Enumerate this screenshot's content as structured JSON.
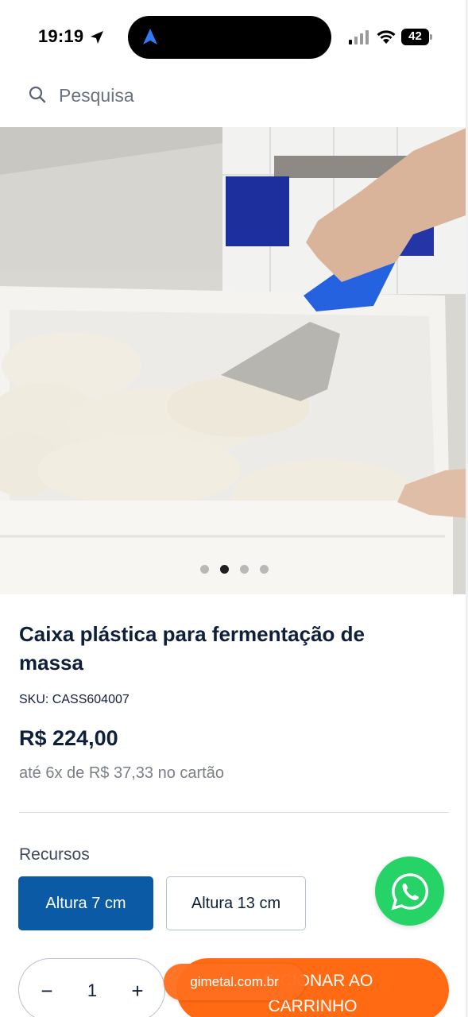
{
  "status_bar": {
    "time": "19:19",
    "battery": "42",
    "icons": [
      "location-arrow-icon",
      "navigation-arrow-icon",
      "cellular-signal-icon",
      "wifi-icon",
      "battery-icon"
    ]
  },
  "search": {
    "placeholder": "Pesquisa",
    "icon": "search-icon"
  },
  "gallery": {
    "image_count": 4,
    "active_index": 1
  },
  "product": {
    "title": "Caixa plástica para fermentação de massa",
    "sku_label": "SKU:",
    "sku_value": "CASS604007",
    "price": "R$ 224,00",
    "installments": "até 6x de R$ 37,33 no cartão"
  },
  "features": {
    "label": "Recursos",
    "options": [
      {
        "label": "Altura 7 cm",
        "selected": true
      },
      {
        "label": "Altura 13 cm",
        "selected": false
      }
    ]
  },
  "whatsapp": {
    "icon": "whatsapp-icon",
    "color": "#25D366"
  },
  "purchase": {
    "quantity": "1",
    "minus": "−",
    "plus": "+",
    "add_to_cart_line1": "ADICIONAR AO",
    "add_to_cart_line2": "CARRINHO"
  },
  "browser": {
    "domain": "gimetal.com.br"
  },
  "colors": {
    "primary": "#0B5AA6",
    "accent": "#FF6A13",
    "text": "#0F1F3A"
  }
}
